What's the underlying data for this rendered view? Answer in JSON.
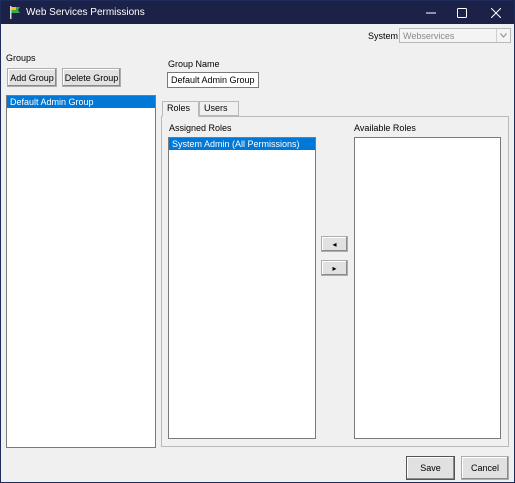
{
  "window": {
    "title": "Web Services Permissions",
    "controls": [
      "minimize-icon",
      "maximize-icon",
      "close-icon"
    ]
  },
  "system": {
    "label": "System",
    "selected": "Webservices"
  },
  "groups": {
    "label": "Groups",
    "add_label": "Add Group",
    "delete_label": "Delete Group",
    "items": [
      {
        "label": "Default Admin Group",
        "selected": true
      }
    ]
  },
  "group_name": {
    "label": "Group Name",
    "value": "Default Admin Group"
  },
  "tabs": [
    {
      "label": "Roles",
      "active": true
    },
    {
      "label": "Users",
      "active": false
    }
  ],
  "roles": {
    "assigned_label": "Assigned Roles",
    "available_label": "Available Roles",
    "assigned": [
      {
        "label": "System Admin (All Permissions)",
        "selected": true
      }
    ],
    "available": [],
    "move_left": "◂",
    "move_right": "▸"
  },
  "footer": {
    "save_label": "Save",
    "cancel_label": "Cancel"
  },
  "colors": {
    "titlebar": "#1c2148",
    "selection": "#0078d7"
  }
}
